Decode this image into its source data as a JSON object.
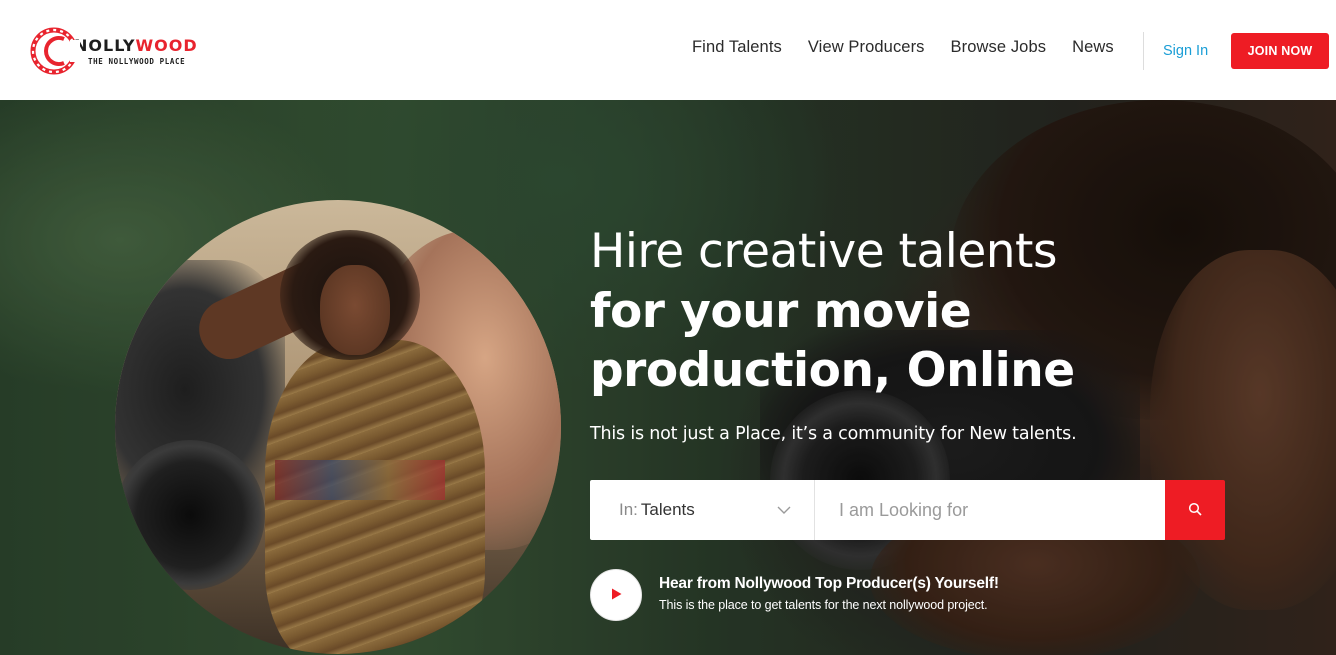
{
  "brand": {
    "name_part1": "NOLLY",
    "name_part2": "WOOD",
    "tagline": "THE NOLLYWOOD PLACE",
    "accent_color": "#ee1c24"
  },
  "nav": {
    "items": [
      {
        "label": "Find Talents"
      },
      {
        "label": "View Producers"
      },
      {
        "label": "Browse Jobs"
      },
      {
        "label": "News"
      }
    ],
    "sign_in": "Sign In",
    "join_now": "JOIN NOW",
    "sign_in_color": "#1a9ed6"
  },
  "hero": {
    "headline_line1": "Hire creative talents",
    "headline_line2": "for your movie",
    "headline_line3": "production, Online",
    "subtitle": "This is not just a Place, it’s a community for New talents.",
    "search": {
      "select_prefix": "In:",
      "select_value": "Talents",
      "placeholder": "I am Looking for",
      "button_icon": "search-icon"
    },
    "promo": {
      "icon": "play-icon",
      "title": "Hear from Nollywood Top Producer(s) Yourself!",
      "subtitle": "This is the place to get talents for the next nollywood project."
    }
  }
}
